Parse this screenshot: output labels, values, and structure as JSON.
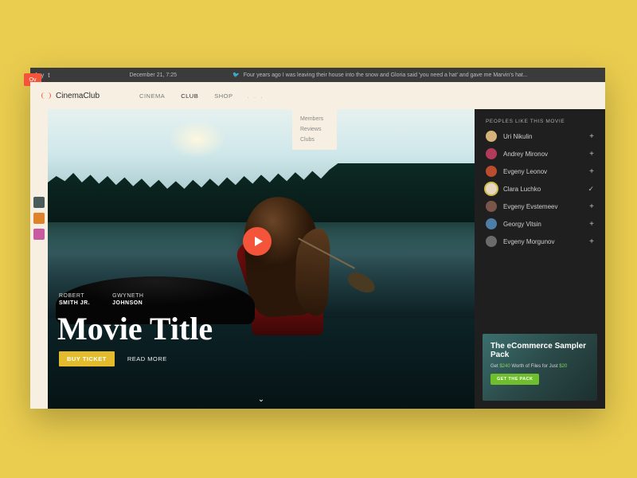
{
  "topbar": {
    "timestamp": "December 21, 7:25",
    "tweet": "Four years ago I was leaving their house into the snow and Gloria said 'you need a hat' and gave me Marvin's hat..."
  },
  "badge": "Ov",
  "brand": "CinemaClub",
  "nav": {
    "items": [
      "CINEMA",
      "CLUB",
      "SHOP"
    ],
    "active": 1,
    "dropdown": [
      "Members",
      "Reviews",
      "Clubs"
    ]
  },
  "hero": {
    "credits": [
      {
        "first": "ROBERT",
        "last": "SMITH JR."
      },
      {
        "first": "GWYNETH",
        "last": "JOHNSON"
      }
    ],
    "title": "Movie Title",
    "buy_label": "BUY TICKET",
    "read_more": "READ MORE"
  },
  "sidebar": {
    "title": "PEOPLES LIKE THIS MOVIE",
    "people": [
      {
        "name": "Uri Nikulin",
        "avatar": "#d4b27a",
        "selected": false
      },
      {
        "name": "Andrey Mironov",
        "avatar": "#b23b5c",
        "selected": false
      },
      {
        "name": "Evgeny Leonov",
        "avatar": "#b94d2d",
        "selected": false
      },
      {
        "name": "Clara Luchko",
        "avatar": "#e8d6c1",
        "selected": true
      },
      {
        "name": "Evgeny Evstemeev",
        "avatar": "#7a564a",
        "selected": false
      },
      {
        "name": "Georgy Vitsin",
        "avatar": "#4d7ea8",
        "selected": false
      },
      {
        "name": "Evgeny Morgunov",
        "avatar": "#6b6b6b",
        "selected": false
      }
    ]
  },
  "promo": {
    "title": "The eCommerce Sampler Pack",
    "sub_pre": "Get ",
    "sub_amount1": "$240",
    "sub_mid": " Worth of Files for Just ",
    "sub_amount2": "$20",
    "cta": "GET THE PACK"
  },
  "rail_thumbs": [
    {
      "bg": "#4a5b5c"
    },
    {
      "bg": "#e0812c"
    },
    {
      "bg": "#c85aa0"
    }
  ]
}
